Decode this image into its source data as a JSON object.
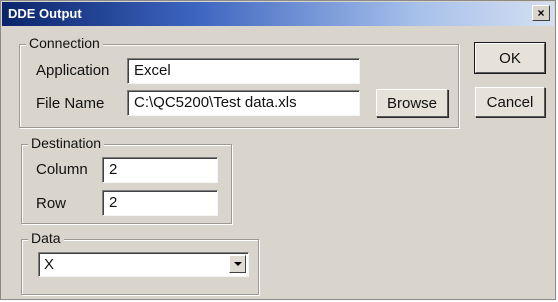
{
  "window": {
    "title": "DDE Output",
    "close_label": "×"
  },
  "connection": {
    "legend": "Connection",
    "application_label": "Application",
    "application_value": "Excel",
    "file_name_label": "File Name",
    "file_name_value": "C:\\QC5200\\Test data.xls",
    "browse_label": "Browse"
  },
  "buttons": {
    "ok_label": "OK",
    "cancel_label": "Cancel"
  },
  "destination": {
    "legend": "Destination",
    "column_label": "Column",
    "column_value": "2",
    "row_label": "Row",
    "row_value": "2"
  },
  "data": {
    "legend": "Data",
    "selected_value": "X"
  },
  "icons": {
    "close": "close-icon",
    "dropdown": "chevron-down-icon"
  }
}
